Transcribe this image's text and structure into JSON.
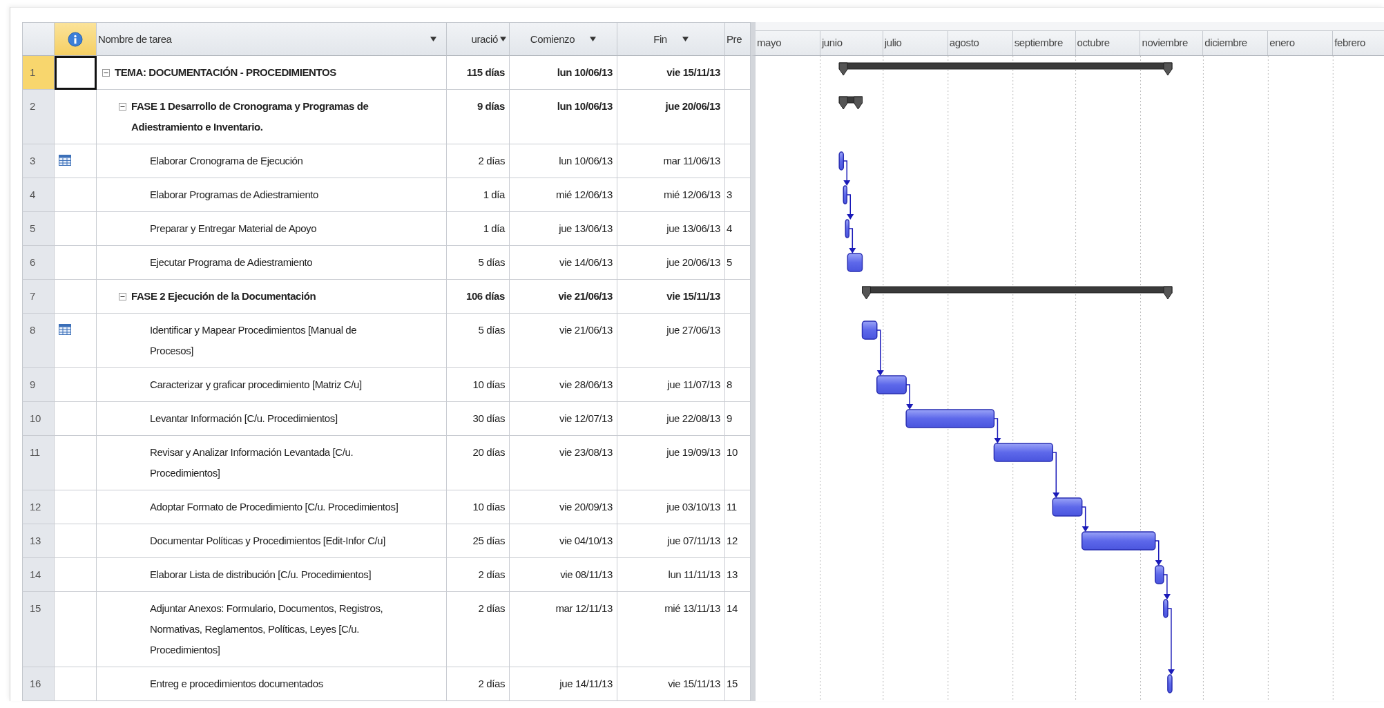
{
  "columns": [
    {
      "kind": "name",
      "label": "Nombre de tarea",
      "dropdown": true
    },
    {
      "kind": "duration",
      "label": "uració",
      "dropdown": true
    },
    {
      "kind": "start",
      "label": "Comienzo",
      "dropdown": true
    },
    {
      "kind": "finish",
      "label": "Fin",
      "dropdown": true
    },
    {
      "kind": "predecessor",
      "label": "Pre",
      "dropdown": false
    }
  ],
  "timescale": [
    "mayo",
    "junio",
    "julio",
    "agosto",
    "septiembre",
    "octubre",
    "noviembre",
    "diciembre",
    "enero",
    "febrero"
  ],
  "tasks": [
    {
      "id": "1",
      "kind": "summary",
      "selected": true,
      "expanded": true,
      "name": "TEMA: DOCUMENTACIÓN - PROCEDIMIENTOS",
      "duration": "115 días",
      "start": "lun 10/06/13",
      "finish": "vie 15/11/13",
      "children": [
        {
          "id": "2",
          "kind": "summary",
          "selected": false,
          "expanded": true,
          "name": "FASE 1 Desarrollo de Cronograma y Programas de Adiestramiento e Inventario.",
          "duration": "9 días",
          "start": "lun 10/06/13",
          "finish": "jue 20/06/13",
          "children": [
            {
              "id": "3",
              "kind": "task",
              "selected": false,
              "calendar": true,
              "name": "Elaborar Cronograma de Ejecución",
              "duration": "2 días",
              "start": "lun 10/06/13",
              "finish": "mar 11/06/13"
            },
            {
              "id": "4",
              "kind": "task",
              "selected": false,
              "name": "Elaborar Programas de Adiestramiento",
              "duration": "1 día",
              "start": "mié 12/06/13",
              "finish": "mié 12/06/13",
              "predecessor": "3"
            },
            {
              "id": "5",
              "kind": "task",
              "selected": false,
              "name": "Preparar y Entregar Material de Apoyo",
              "duration": "1 día",
              "start": "jue 13/06/13",
              "finish": "jue 13/06/13",
              "predecessor": "4"
            },
            {
              "id": "6",
              "kind": "task",
              "selected": false,
              "name": "Ejecutar Programa de Adiestramiento",
              "duration": "5 días",
              "start": "vie 14/06/13",
              "finish": "jue 20/06/13",
              "predecessor": "5"
            }
          ]
        },
        {
          "id": "7",
          "kind": "summary",
          "selected": false,
          "expanded": true,
          "name": "FASE 2 Ejecución de la Documentación",
          "duration": "106 días",
          "start": "vie 21/06/13",
          "finish": "vie 15/11/13",
          "children": [
            {
              "id": "8",
              "kind": "task",
              "selected": false,
              "calendar": true,
              "name": "Identificar y Mapear Procedimientos [Manual de Procesos]",
              "duration": "5 días",
              "start": "vie 21/06/13",
              "finish": "jue 27/06/13"
            },
            {
              "id": "9",
              "kind": "task",
              "selected": false,
              "name": "Caracterizar y graficar procedimiento [Matriz C/u]",
              "duration": "10 días",
              "start": "vie 28/06/13",
              "finish": "jue 11/07/13",
              "predecessor": "8"
            },
            {
              "id": "10",
              "kind": "task",
              "selected": false,
              "name": "Levantar Información [C/u. Procedimientos]",
              "duration": "30 días",
              "start": "vie 12/07/13",
              "finish": "jue 22/08/13",
              "predecessor": "9"
            },
            {
              "id": "11",
              "kind": "task",
              "selected": false,
              "name": "Revisar y Analizar Información Levantada [C/u. Procedimientos]",
              "duration": "20 días",
              "start": "vie 23/08/13",
              "finish": "jue 19/09/13",
              "predecessor": "10"
            },
            {
              "id": "12",
              "kind": "task",
              "selected": false,
              "name": "Adoptar Formato de Procedimiento [C/u. Procedimientos]",
              "duration": "10 días",
              "start": "vie 20/09/13",
              "finish": "jue 03/10/13",
              "predecessor": "11"
            },
            {
              "id": "13",
              "kind": "task",
              "selected": false,
              "name": "Documentar Políticas y Procedimientos [Edit-Infor C/u]",
              "duration": "25 días",
              "start": "vie 04/10/13",
              "finish": "jue 07/11/13",
              "predecessor": "12"
            },
            {
              "id": "14",
              "kind": "task",
              "selected": false,
              "name": "Elaborar Lista de distribución [C/u. Procedimientos]",
              "duration": "2 días",
              "start": "vie 08/11/13",
              "finish": "lun 11/11/13",
              "predecessor": "13"
            },
            {
              "id": "15",
              "kind": "task",
              "selected": false,
              "name": "Adjuntar Anexos: Formulario, Documentos, Registros, Normativas, Reglamentos, Políticas, Leyes [C/u. Procedimientos]",
              "duration": "2 días",
              "start": "mar 12/11/13",
              "finish": "mié 13/11/13",
              "predecessor": "14"
            },
            {
              "id": "16",
              "kind": "task",
              "selected": false,
              "name": "Entreg e procedimientos documentados",
              "duration": "2 días",
              "start": "jue 14/11/13",
              "finish": "vie 15/11/13",
              "predecessor": "15"
            }
          ]
        }
      ]
    }
  ]
}
